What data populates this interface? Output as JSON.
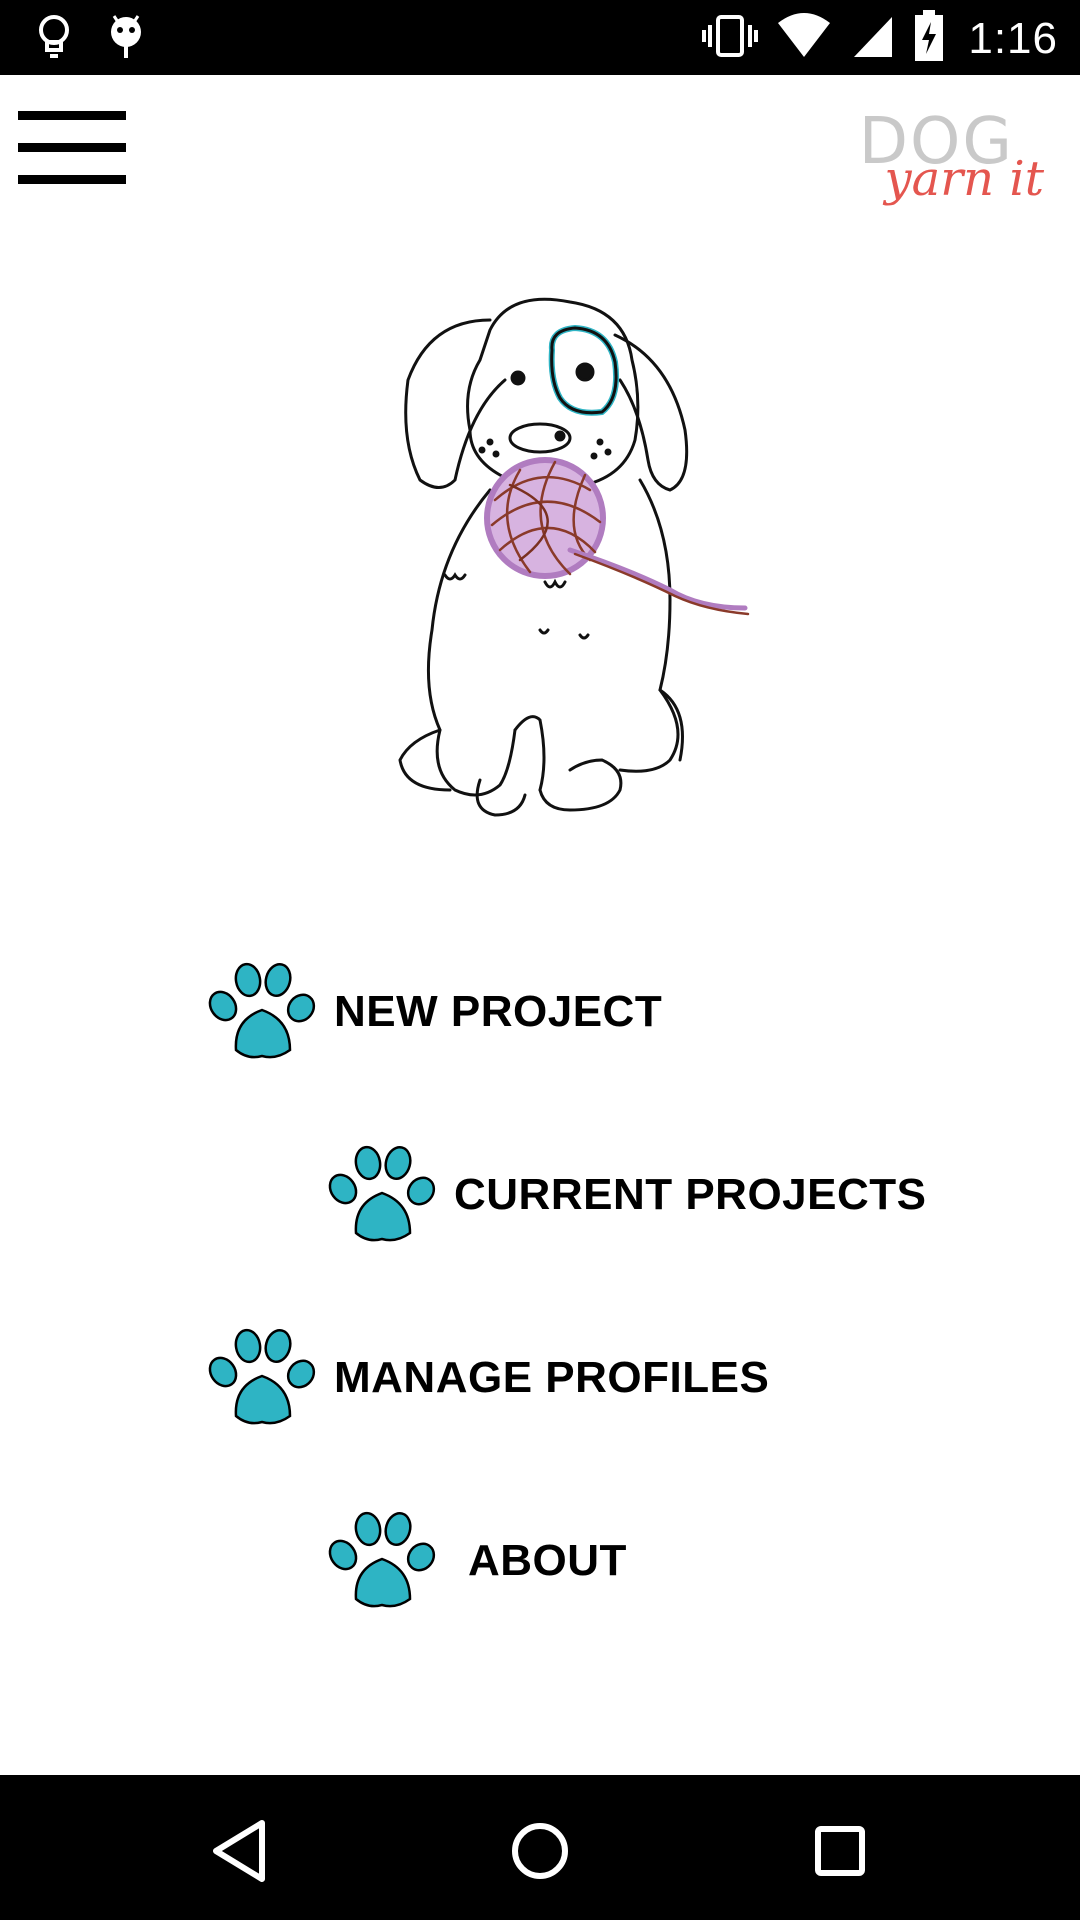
{
  "status_bar": {
    "time": "1:16",
    "icons": [
      "lightbulb-icon",
      "android-icon",
      "vibrate-icon",
      "wifi-icon",
      "signal-icon",
      "battery-charging-icon"
    ]
  },
  "header": {
    "menu_icon": "hamburger-menu-icon",
    "logo": {
      "line1": "DOG",
      "line2": "yarn it"
    }
  },
  "hero": {
    "image": "dog-with-yarn-illustration"
  },
  "menu": {
    "items": [
      {
        "label": "NEW PROJECT",
        "icon": "paw-icon"
      },
      {
        "label": "CURRENT PROJECTS",
        "icon": "paw-icon"
      },
      {
        "label": "MANAGE PROFILES",
        "icon": "paw-icon"
      },
      {
        "label": "ABOUT",
        "icon": "paw-icon"
      }
    ]
  },
  "nav_bar": {
    "buttons": [
      "back-icon",
      "home-icon",
      "recents-icon"
    ]
  },
  "colors": {
    "paw": "#2eb4c4",
    "logo_gray": "#c9c9c9",
    "logo_red": "#e4564f",
    "yarn": "#b07cc0"
  }
}
